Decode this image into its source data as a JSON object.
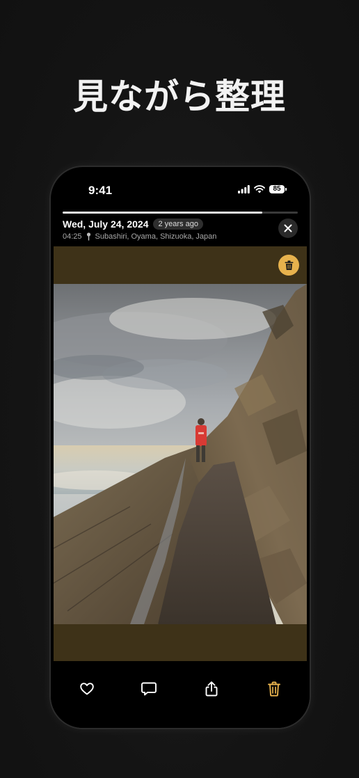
{
  "headline": "見ながら整理",
  "status_bar": {
    "time": "9:41",
    "battery": "85",
    "icons": [
      "signal-icon",
      "wifi-icon",
      "battery-icon"
    ]
  },
  "viewer": {
    "progress": 0.85,
    "date": "Wed, July 24, 2024",
    "age": "2 years ago",
    "time": "04:25",
    "location": "Subashiri, Oyama, Shizuoka, Japan",
    "close_icon": "close-icon",
    "trash_icon": "trash-icon"
  },
  "toolbar": {
    "items": [
      "heart-icon",
      "comment-icon",
      "share-icon",
      "trash-icon"
    ]
  },
  "colors": {
    "background": "#141414",
    "accent": "#e7b24d",
    "photo_matte": "#3e3218"
  }
}
